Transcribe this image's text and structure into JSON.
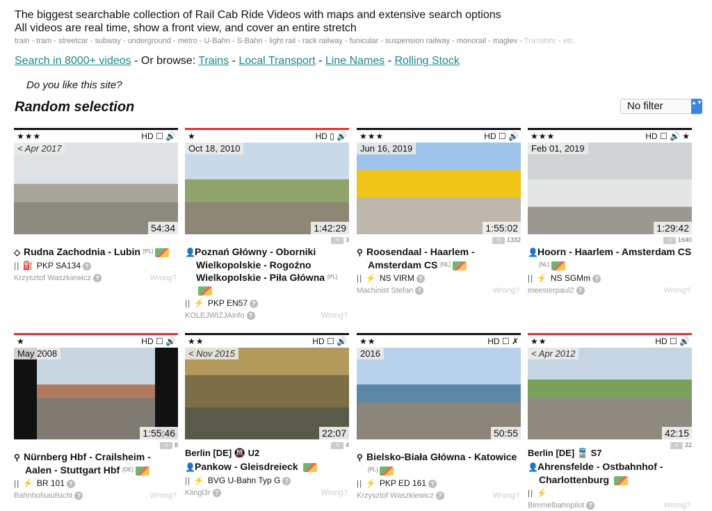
{
  "intro": {
    "line1": "The biggest searchable collection of Rail Cab Ride Videos with maps and extensive search options",
    "line2": "All videos are real time, show a front view, and cover an entire stretch",
    "keywords": "train - tram - streetcar - subway - underground - metro - U-Bahn - S-Bahn - light rail - rack railway - funicular - suspension railway - monorail - maglev - ",
    "keywords_last": "Translohr - etc."
  },
  "nav": {
    "search_label": "Search in 8000+ videos",
    "browse_text": " - Or browse: ",
    "trains": "Trains",
    "local": "Local Transport",
    "lines": "Line Names",
    "rolling": "Rolling Stock",
    "sep": " - "
  },
  "like_text": "Do you like this site?",
  "random_heading": "Random selection",
  "filter": {
    "value": "No filter",
    "arrows": "▲▼"
  },
  "colors": {
    "accent": "#1a8a8a",
    "red_bar": "#dd3333",
    "dark_bar": "#111111"
  },
  "wrong_label": "Wrong?",
  "q_mark": "?",
  "cards": [
    {
      "stars": "★★★",
      "flags": "HD ☐ 🔊",
      "date": "< Apr 2017",
      "duration": "54:34",
      "views": "",
      "tag": "",
      "title": "Rudna Zachodnia - Lubin",
      "symbol": "◇",
      "country": "[PL]",
      "vehicle_prefix": "|| ⛽",
      "vehicle": "PKP SA134",
      "author": "Krzysztof Waszkiewicz"
    },
    {
      "stars": "★",
      "flags": "HD ▯ 🔊",
      "date": "Oct 18, 2010",
      "duration": "1:42:29",
      "views": "3",
      "tag": "",
      "title": "Poznań Główny - Oborniki Wielkopolskie - Rogoźno Wielkopolskie - Piła Główna",
      "symbol": "👤",
      "country": "[PL]",
      "vehicle_prefix": "|| ⚡",
      "vehicle": "PKP EN57",
      "author": "KOLEJWIZJAinfo"
    },
    {
      "stars": "★★★",
      "flags": "HD ☐ 🔊",
      "date": "Jun 16, 2019",
      "duration": "1:55:02",
      "views": "1332",
      "tag": "",
      "title": "Roosendaal - Haarlem - Amsterdam CS",
      "symbol": "⚲",
      "country": "[NL]",
      "vehicle_prefix": "|| ⚡",
      "vehicle": "NS VIRM",
      "author": "Machinist Stefan"
    },
    {
      "stars": "★★★",
      "flags": "HD ☐ 🔊 ★",
      "date": "Feb 01, 2019",
      "duration": "1:29:42",
      "views": "1640",
      "tag": "",
      "title": "Hoorn - Haarlem - Amsterdam CS",
      "symbol": "👤",
      "country": "[NL]",
      "vehicle_prefix": "|| ⚡",
      "vehicle": "NS SGMm",
      "author": "meesterpaul2"
    },
    {
      "stars": "★",
      "flags": "HD ☐ 🔊",
      "date": "May 2008",
      "duration": "1:55:46",
      "views": "8",
      "tag": "",
      "title": "Nürnberg Hbf - Crailsheim - Aalen - Stuttgart Hbf",
      "symbol": "⚲",
      "country": "[DE]",
      "vehicle_prefix": "|| ⚡",
      "vehicle": "BR 101",
      "author": "Bahnhofsaufsicht"
    },
    {
      "stars": "★★",
      "flags": "HD ☐ 🔊",
      "date": "< Nov 2015",
      "duration": "22:07",
      "views": "4",
      "tag": "Berlin [DE] 🚇 U2",
      "title": "Pankow - Gleisdreieck",
      "symbol": "👤",
      "country": "",
      "vehicle_prefix": "|| ⚡",
      "vehicle": "BVG U-Bahn Typ G",
      "author": "Klingl3r"
    },
    {
      "stars": "★★",
      "flags": "HD ☐ ✗",
      "date": "2016",
      "duration": "50:55",
      "views": "",
      "tag": "",
      "title": "Bielsko-Biała Główna - Katowice",
      "symbol": "⚲",
      "country": "[PL]",
      "vehicle_prefix": "|| ⚡",
      "vehicle": "PKP ED 161",
      "author": "Krzysztof Waszkiewicz"
    },
    {
      "stars": "★★",
      "flags": "HD ☐ 🔊",
      "date": "< Apr 2012",
      "duration": "42:15",
      "views": "22",
      "tag": "Berlin [DE] 🚆 S7",
      "title": "Ahrensfelde - Ostbahnhof - Charlottenburg",
      "symbol": "👤",
      "country": "",
      "vehicle_prefix": "|| ⚡",
      "vehicle": "",
      "author": "Bimmelbahnpilot"
    }
  ]
}
